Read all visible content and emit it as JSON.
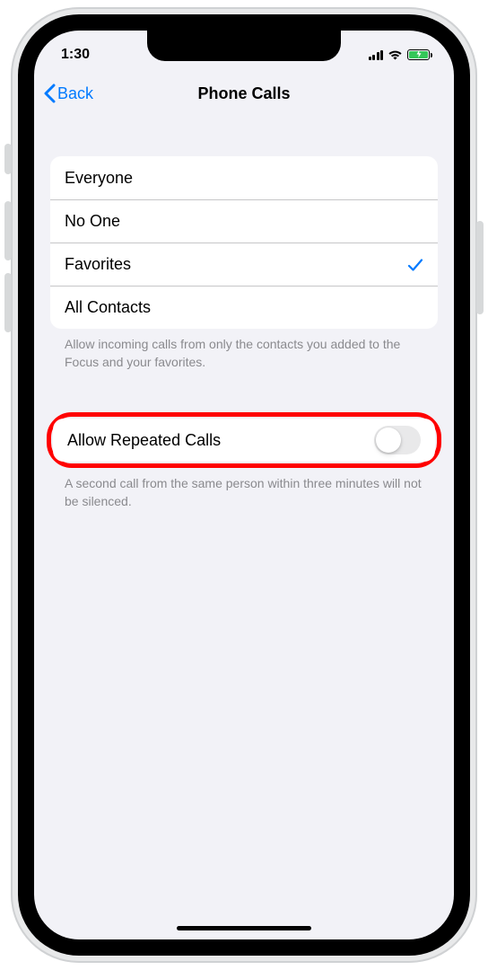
{
  "status": {
    "time": "1:30"
  },
  "nav": {
    "back_label": "Back",
    "title": "Phone Calls"
  },
  "allow_from": {
    "options": [
      {
        "label": "Everyone",
        "selected": false
      },
      {
        "label": "No One",
        "selected": false
      },
      {
        "label": "Favorites",
        "selected": true
      },
      {
        "label": "All Contacts",
        "selected": false
      }
    ],
    "footer": "Allow incoming calls from only the contacts you added to the Focus and your favorites."
  },
  "repeated_calls": {
    "label": "Allow Repeated Calls",
    "enabled": false,
    "footer": "A second call from the same person within three minutes will not be silenced."
  },
  "colors": {
    "accent": "#007aff",
    "highlight": "#ff0000",
    "bg": "#f2f2f7",
    "battery_fill": "#34c759"
  }
}
